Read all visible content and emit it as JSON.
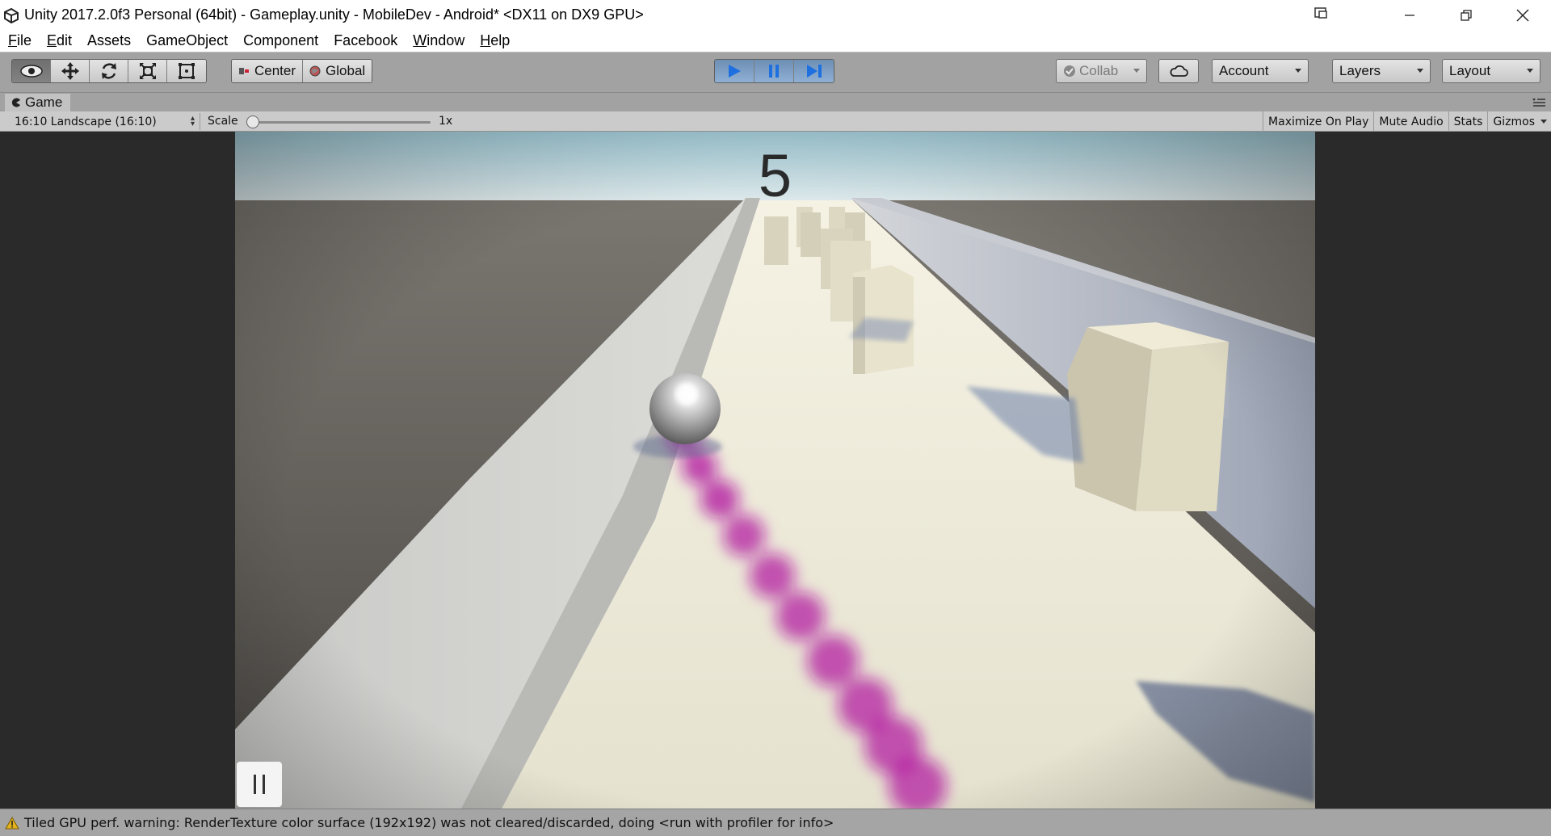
{
  "window": {
    "title": "Unity 2017.2.0f3 Personal (64bit) - Gameplay.unity - MobileDev - Android* <DX11 on DX9 GPU>"
  },
  "menu": [
    {
      "label": "File",
      "u": "F",
      "rest": "ile"
    },
    {
      "label": "Edit",
      "u": "E",
      "rest": "dit"
    },
    {
      "label": "Assets",
      "u": "",
      "rest": "Assets"
    },
    {
      "label": "GameObject",
      "u": "",
      "rest": "GameObject"
    },
    {
      "label": "Component",
      "u": "",
      "rest": "Component"
    },
    {
      "label": "Facebook",
      "u": "",
      "rest": "Facebook"
    },
    {
      "label": "Window",
      "u": "W",
      "rest": "indow"
    },
    {
      "label": "Help",
      "u": "H",
      "rest": "elp"
    }
  ],
  "toolbar": {
    "center_label": "Center",
    "global_label": "Global",
    "collab_label": "Collab",
    "account_label": "Account",
    "layers_label": "Layers",
    "layout_label": "Layout"
  },
  "game_tab": {
    "label": "Game"
  },
  "game_view": {
    "aspect": "16:10 Landscape (16:10)",
    "scale_label": "Scale",
    "scale_value": "1x",
    "maximize_label": "Maximize On Play",
    "mute_label": "Mute Audio",
    "stats_label": "Stats",
    "gizmos_label": "Gizmos"
  },
  "game": {
    "score": "5"
  },
  "status": {
    "message": "Tiled GPU perf. warning: RenderTexture color surface  (192x192) was not cleared/discarded, doing <run with profiler for info>"
  },
  "colors": {
    "play_active": "#3b7fd9",
    "trail": "#b0139e",
    "warning": "#d4a017"
  },
  "icons": {
    "view_tool": "eye-icon",
    "move_tool": "move-arrows-icon",
    "rotate_tool": "rotate-icon",
    "scale_tool": "scale-icon",
    "rect_tool": "rect-icon",
    "cloud": "cloud-icon",
    "warning": "warning-triangle-icon"
  }
}
